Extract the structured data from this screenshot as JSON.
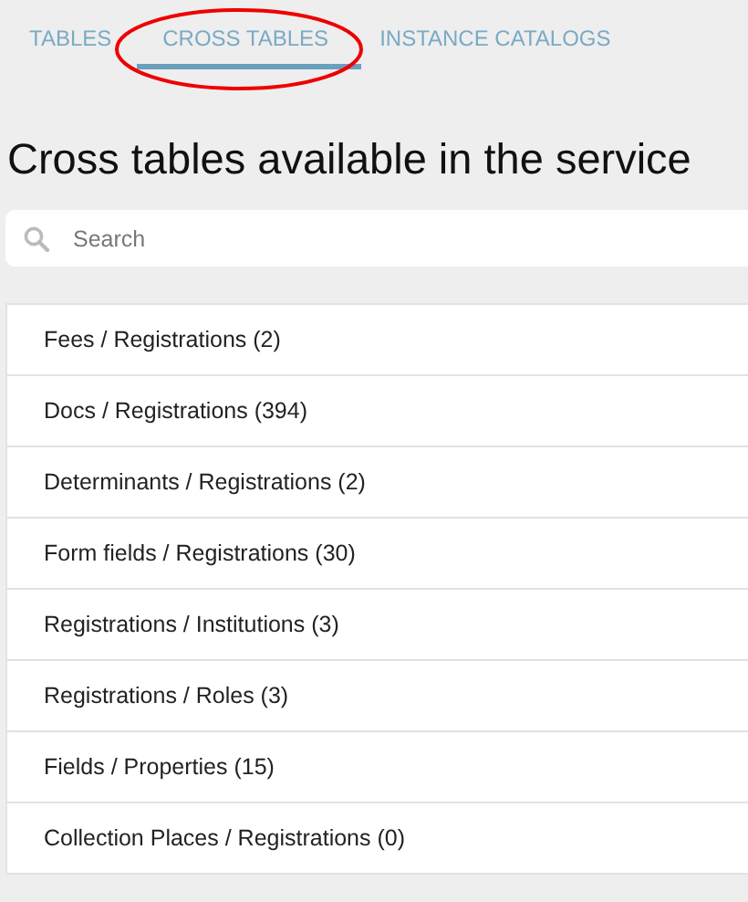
{
  "tabs": [
    {
      "label": "TABLES",
      "selected": false
    },
    {
      "label": "CROSS TABLES",
      "selected": true
    },
    {
      "label": "INSTANCE CATALOGS",
      "selected": false
    }
  ],
  "heading": "Cross tables available in the service",
  "search": {
    "placeholder": "Search"
  },
  "items": [
    {
      "label": "Fees / Registrations (2)"
    },
    {
      "label": "Docs / Registrations (394)"
    },
    {
      "label": "Determinants / Registrations (2)"
    },
    {
      "label": "Form fields / Registrations (30)"
    },
    {
      "label": "Registrations / Institutions (3)"
    },
    {
      "label": "Registrations / Roles (3)"
    },
    {
      "label": "Fields / Properties (15)"
    },
    {
      "label": "Collection Places / Registrations (0)"
    }
  ]
}
